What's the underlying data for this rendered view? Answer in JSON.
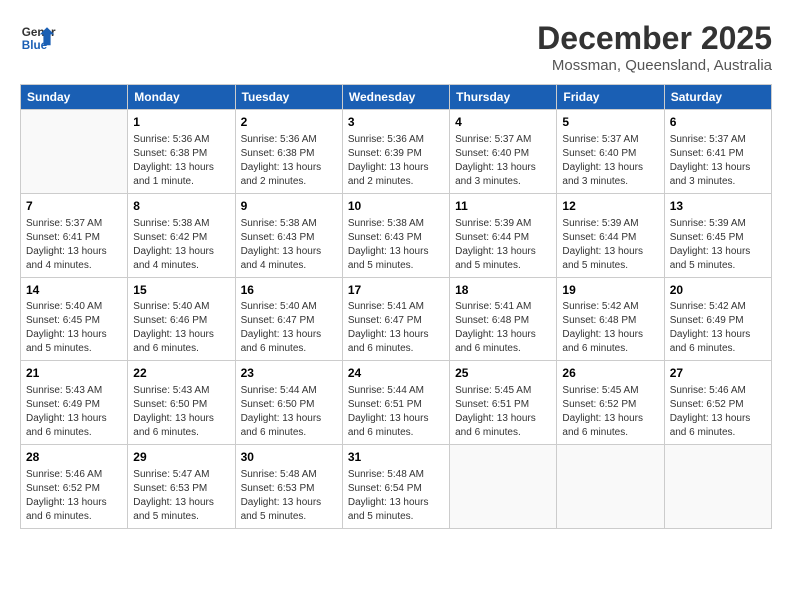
{
  "header": {
    "logo_line1": "General",
    "logo_line2": "Blue",
    "month": "December 2025",
    "location": "Mossman, Queensland, Australia"
  },
  "weekdays": [
    "Sunday",
    "Monday",
    "Tuesday",
    "Wednesday",
    "Thursday",
    "Friday",
    "Saturday"
  ],
  "weeks": [
    [
      {
        "day": "",
        "text": ""
      },
      {
        "day": "1",
        "text": "Sunrise: 5:36 AM\nSunset: 6:38 PM\nDaylight: 13 hours\nand 1 minute."
      },
      {
        "day": "2",
        "text": "Sunrise: 5:36 AM\nSunset: 6:38 PM\nDaylight: 13 hours\nand 2 minutes."
      },
      {
        "day": "3",
        "text": "Sunrise: 5:36 AM\nSunset: 6:39 PM\nDaylight: 13 hours\nand 2 minutes."
      },
      {
        "day": "4",
        "text": "Sunrise: 5:37 AM\nSunset: 6:40 PM\nDaylight: 13 hours\nand 3 minutes."
      },
      {
        "day": "5",
        "text": "Sunrise: 5:37 AM\nSunset: 6:40 PM\nDaylight: 13 hours\nand 3 minutes."
      },
      {
        "day": "6",
        "text": "Sunrise: 5:37 AM\nSunset: 6:41 PM\nDaylight: 13 hours\nand 3 minutes."
      }
    ],
    [
      {
        "day": "7",
        "text": "Sunrise: 5:37 AM\nSunset: 6:41 PM\nDaylight: 13 hours\nand 4 minutes."
      },
      {
        "day": "8",
        "text": "Sunrise: 5:38 AM\nSunset: 6:42 PM\nDaylight: 13 hours\nand 4 minutes."
      },
      {
        "day": "9",
        "text": "Sunrise: 5:38 AM\nSunset: 6:43 PM\nDaylight: 13 hours\nand 4 minutes."
      },
      {
        "day": "10",
        "text": "Sunrise: 5:38 AM\nSunset: 6:43 PM\nDaylight: 13 hours\nand 5 minutes."
      },
      {
        "day": "11",
        "text": "Sunrise: 5:39 AM\nSunset: 6:44 PM\nDaylight: 13 hours\nand 5 minutes."
      },
      {
        "day": "12",
        "text": "Sunrise: 5:39 AM\nSunset: 6:44 PM\nDaylight: 13 hours\nand 5 minutes."
      },
      {
        "day": "13",
        "text": "Sunrise: 5:39 AM\nSunset: 6:45 PM\nDaylight: 13 hours\nand 5 minutes."
      }
    ],
    [
      {
        "day": "14",
        "text": "Sunrise: 5:40 AM\nSunset: 6:45 PM\nDaylight: 13 hours\nand 5 minutes."
      },
      {
        "day": "15",
        "text": "Sunrise: 5:40 AM\nSunset: 6:46 PM\nDaylight: 13 hours\nand 6 minutes."
      },
      {
        "day": "16",
        "text": "Sunrise: 5:40 AM\nSunset: 6:47 PM\nDaylight: 13 hours\nand 6 minutes."
      },
      {
        "day": "17",
        "text": "Sunrise: 5:41 AM\nSunset: 6:47 PM\nDaylight: 13 hours\nand 6 minutes."
      },
      {
        "day": "18",
        "text": "Sunrise: 5:41 AM\nSunset: 6:48 PM\nDaylight: 13 hours\nand 6 minutes."
      },
      {
        "day": "19",
        "text": "Sunrise: 5:42 AM\nSunset: 6:48 PM\nDaylight: 13 hours\nand 6 minutes."
      },
      {
        "day": "20",
        "text": "Sunrise: 5:42 AM\nSunset: 6:49 PM\nDaylight: 13 hours\nand 6 minutes."
      }
    ],
    [
      {
        "day": "21",
        "text": "Sunrise: 5:43 AM\nSunset: 6:49 PM\nDaylight: 13 hours\nand 6 minutes."
      },
      {
        "day": "22",
        "text": "Sunrise: 5:43 AM\nSunset: 6:50 PM\nDaylight: 13 hours\nand 6 minutes."
      },
      {
        "day": "23",
        "text": "Sunrise: 5:44 AM\nSunset: 6:50 PM\nDaylight: 13 hours\nand 6 minutes."
      },
      {
        "day": "24",
        "text": "Sunrise: 5:44 AM\nSunset: 6:51 PM\nDaylight: 13 hours\nand 6 minutes."
      },
      {
        "day": "25",
        "text": "Sunrise: 5:45 AM\nSunset: 6:51 PM\nDaylight: 13 hours\nand 6 minutes."
      },
      {
        "day": "26",
        "text": "Sunrise: 5:45 AM\nSunset: 6:52 PM\nDaylight: 13 hours\nand 6 minutes."
      },
      {
        "day": "27",
        "text": "Sunrise: 5:46 AM\nSunset: 6:52 PM\nDaylight: 13 hours\nand 6 minutes."
      }
    ],
    [
      {
        "day": "28",
        "text": "Sunrise: 5:46 AM\nSunset: 6:52 PM\nDaylight: 13 hours\nand 6 minutes."
      },
      {
        "day": "29",
        "text": "Sunrise: 5:47 AM\nSunset: 6:53 PM\nDaylight: 13 hours\nand 5 minutes."
      },
      {
        "day": "30",
        "text": "Sunrise: 5:48 AM\nSunset: 6:53 PM\nDaylight: 13 hours\nand 5 minutes."
      },
      {
        "day": "31",
        "text": "Sunrise: 5:48 AM\nSunset: 6:54 PM\nDaylight: 13 hours\nand 5 minutes."
      },
      {
        "day": "",
        "text": ""
      },
      {
        "day": "",
        "text": ""
      },
      {
        "day": "",
        "text": ""
      }
    ]
  ]
}
